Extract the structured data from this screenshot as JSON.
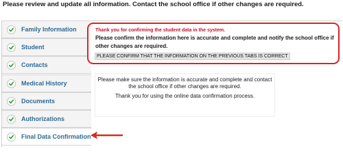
{
  "instruction": "Please review and update all information. Contact the school office if other changes are required.",
  "tabs": [
    {
      "label": "Family Information"
    },
    {
      "label": "Student"
    },
    {
      "label": "Contacts"
    },
    {
      "label": "Medical History"
    },
    {
      "label": "Documents"
    },
    {
      "label": "Authorizations"
    },
    {
      "label": "Final Data Confirmation"
    }
  ],
  "alert": {
    "title": "Thank you for confirming the student data in the system.",
    "text": "Please confirm the information here is accurate and complete and notify the school office if other changes are required.",
    "button_label": "PLEASE CONFIRM THAT THE INFORMATION ON THE PREVIOUS TABS IS CORRECT"
  },
  "info": {
    "message1": "Please make sure the information is accurate and complete and contact the school office if other changes are required.",
    "message2": "Thank you for using the online data confirmation process."
  },
  "colors": {
    "alert_border": "#d82424",
    "tab_label": "#2f6a95",
    "check_green": "#2e9a2e",
    "arrow_red": "#d42a20"
  },
  "icons": {
    "tab_check": "check-circle-icon",
    "pointer": "arrow-left-icon"
  }
}
